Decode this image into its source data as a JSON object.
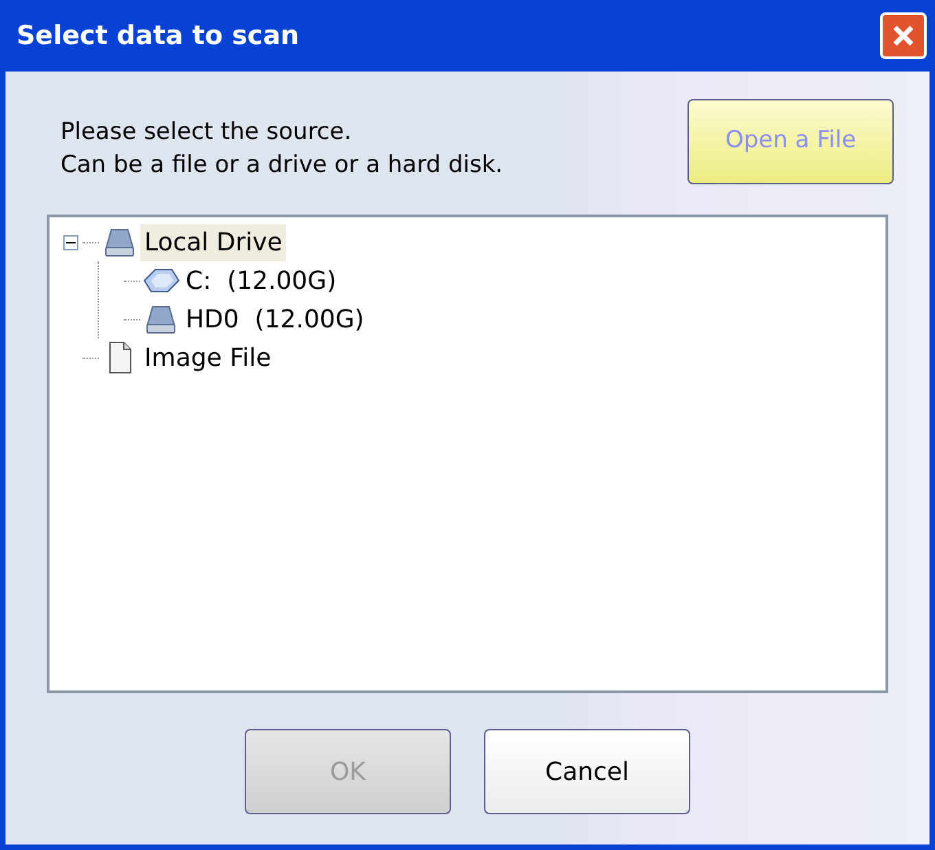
{
  "window": {
    "title": "Select data to scan"
  },
  "instructions": [
    "Please select the source.",
    "Can be a file or a drive or a hard disk."
  ],
  "open_button": {
    "label": "Open a File",
    "disabled": false,
    "hovered": true
  },
  "tree": [
    {
      "label": "Local Drive",
      "kind": "drive",
      "selected": true,
      "expanded": true,
      "children": [
        {
          "label": "C:  (12.00G)",
          "kind": "partition",
          "selected": false
        },
        {
          "label": "HD0  (12.00G)",
          "kind": "drive",
          "selected": false
        }
      ]
    },
    {
      "label": "Image File",
      "kind": "file",
      "selected": false
    }
  ],
  "buttons": [
    {
      "label": "OK",
      "disabled": true
    },
    {
      "label": "Cancel",
      "disabled": false
    }
  ]
}
